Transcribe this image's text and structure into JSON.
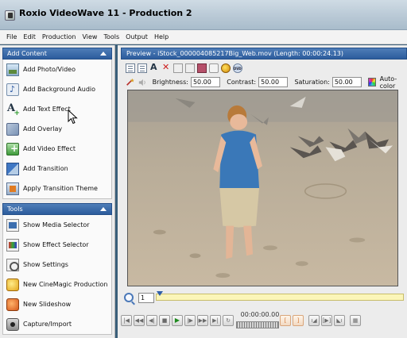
{
  "window": {
    "title": "Roxio VideoWave 11 - Production 2"
  },
  "menu": [
    "File",
    "Edit",
    "Production",
    "View",
    "Tools",
    "Output",
    "Help"
  ],
  "add_content": {
    "header": "Add Content",
    "items": [
      {
        "label": "Add Photo/Video",
        "icon": "photo-video-icon"
      },
      {
        "label": "Add Background Audio",
        "icon": "audio-icon"
      },
      {
        "label": "Add Text Effect",
        "icon": "text-effect-icon"
      },
      {
        "label": "Add Overlay",
        "icon": "overlay-icon"
      },
      {
        "label": "Add Video Effect",
        "icon": "video-effect-icon"
      },
      {
        "label": "Add Transition",
        "icon": "transition-icon"
      },
      {
        "label": "Apply Transition Theme",
        "icon": "transition-theme-icon"
      }
    ]
  },
  "tools": {
    "header": "Tools",
    "items": [
      {
        "label": "Show Media Selector",
        "icon": "media-selector-icon"
      },
      {
        "label": "Show Effect Selector",
        "icon": "effect-selector-icon"
      },
      {
        "label": "Show Settings",
        "icon": "settings-icon"
      },
      {
        "label": "New CineMagic Production",
        "icon": "cinemagic-icon"
      },
      {
        "label": "New Slideshow",
        "icon": "slideshow-icon"
      },
      {
        "label": "Capture/Import",
        "icon": "capture-icon"
      }
    ]
  },
  "preview": {
    "header": "Preview - iStock_000004085217Big_Web.mov (Length: 00:00:24.13)",
    "brightness_label": "Brightness:",
    "brightness": "50.00",
    "contrast_label": "Contrast:",
    "contrast": "50.00",
    "saturation_label": "Saturation:",
    "saturation": "50.00",
    "autocolor_label": "Auto-color"
  },
  "timeline": {
    "frame": "1"
  },
  "transport": {
    "timecode": "00:00:00.00"
  }
}
